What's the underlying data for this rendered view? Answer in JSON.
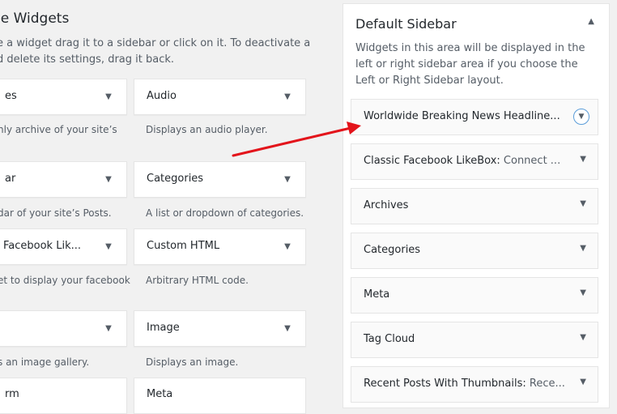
{
  "available": {
    "title": "le Widgets",
    "description": "e a widget drag it to a sidebar or click on it. To deactivate a\nd delete its settings, drag it back."
  },
  "widgets": [
    {
      "label": "es",
      "desc": "hly archive of your site’s"
    },
    {
      "label": "Audio",
      "desc": "Displays an audio player."
    },
    {
      "label": "ar",
      "desc": "dar of your site’s Posts."
    },
    {
      "label": "Categories",
      "desc": "A list or dropdown of categories."
    },
    {
      "label": "Facebook Lik...",
      "desc": "et to display your facebook"
    },
    {
      "label": "Custom HTML",
      "desc": "Arbitrary HTML code."
    },
    {
      "label": "",
      "desc": "s an image gallery."
    },
    {
      "label": "Image",
      "desc": "Displays an image."
    },
    {
      "label": "rm",
      "desc": ""
    },
    {
      "label": "Meta",
      "desc": ""
    }
  ],
  "sidebar": {
    "title": "Default Sidebar",
    "description": "Widgets in this area will be displayed in the left or right sidebar area if you choose the Left or Right Sidebar layout.",
    "widgets": [
      {
        "label": "Worldwide Breaking News Headline...",
        "sub": ""
      },
      {
        "label": "Classic Facebook LikeBox:",
        "sub": " Connect ..."
      },
      {
        "label": "Archives",
        "sub": ""
      },
      {
        "label": "Categories",
        "sub": ""
      },
      {
        "label": "Meta",
        "sub": ""
      },
      {
        "label": "Tag Cloud",
        "sub": ""
      },
      {
        "label": "Recent Posts With Thumbnails:",
        "sub": " Rece..."
      }
    ]
  },
  "icons": {
    "dropdown": "triangle-down-icon",
    "collapse": "triangle-up-icon"
  },
  "colors": {
    "annotation_arrow": "#e3141b",
    "focus_ring": "#5b9dd9"
  }
}
